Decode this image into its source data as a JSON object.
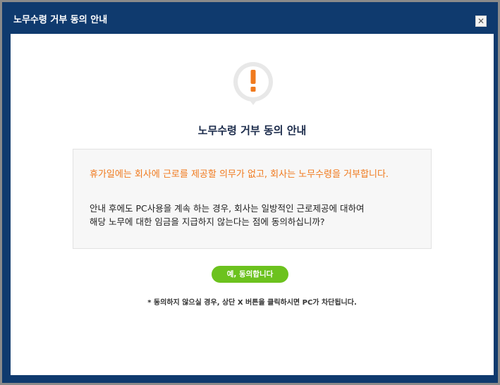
{
  "dialog": {
    "title": "노무수령 거부 동의 안내",
    "close_label": "✕"
  },
  "main": {
    "heading": "노무수령 거부 동의 안내",
    "warning": "휴가일에는 회사에 근로를 제공할 의무가 없고, 회사는 노무수령을 거부합니다.",
    "body_line1": "안내 후에도 PC사용을 계속 하는 경우, 회사는 일방적인 근로제공에 대하여",
    "body_line2": "해당 노무에 대한 임금을 지급하지 않는다는 점에 동의하십니까?",
    "agree_label": "예, 동의합니다",
    "footnote": "* 동의하지 않으실 경우, 상단 X 버튼을 클릭하시면 PC가 차단됩니다."
  },
  "icons": {
    "alert": "exclamation-bubble-icon",
    "close": "close-icon"
  },
  "colors": {
    "titlebar": "#0f3a6e",
    "accent_orange": "#f07a1e",
    "agree_green": "#6cc21e"
  }
}
